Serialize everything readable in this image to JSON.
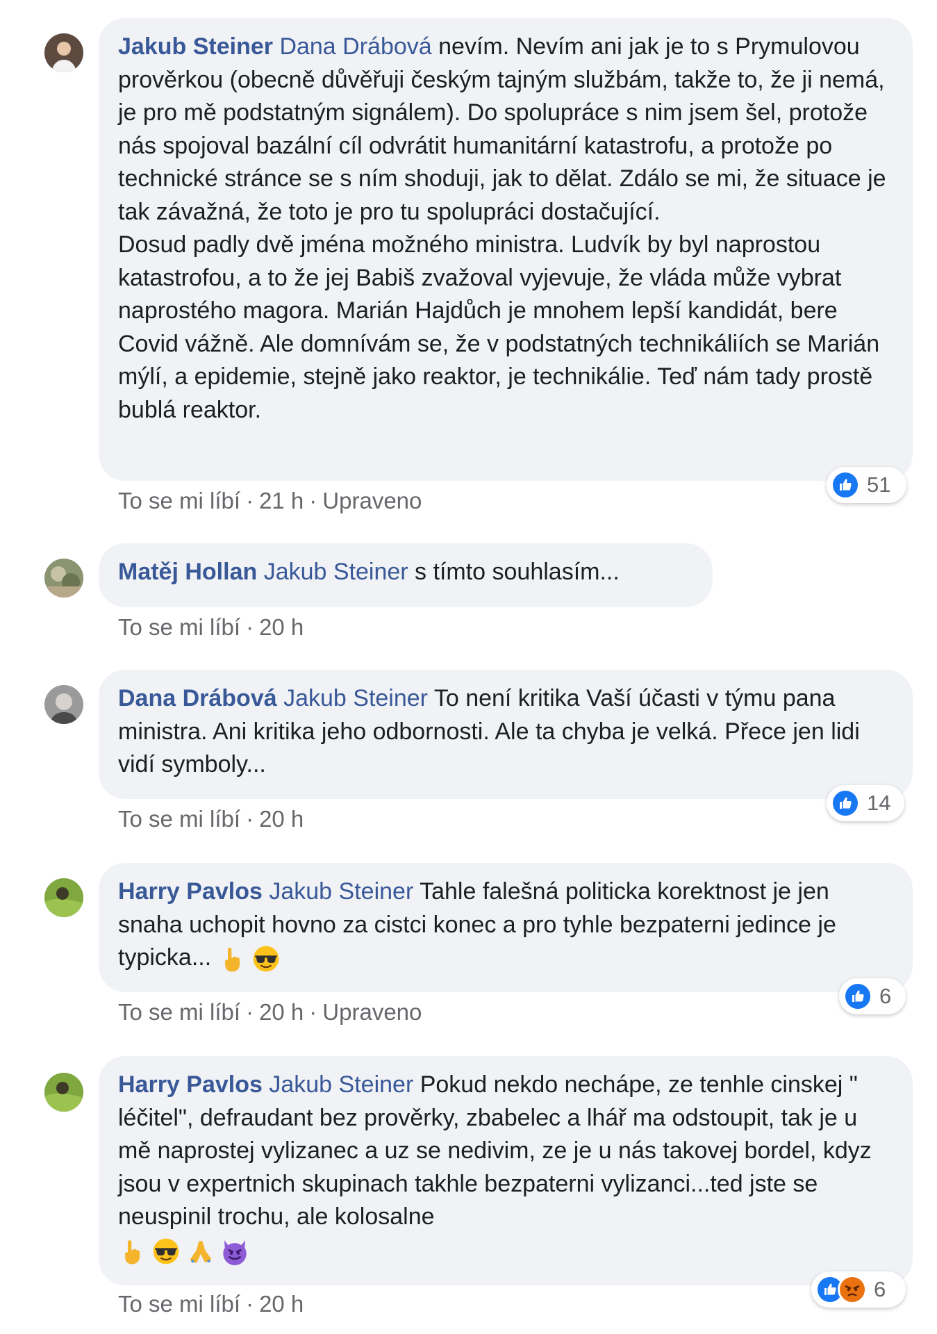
{
  "comments": [
    {
      "author": "Jakub Steiner",
      "tag": "Dana Drábová",
      "text": " nevím. Nevím ani jak je to s Prymulovou prověrkou (obecně důvěřuji českým tajným službám, takže to, že ji nemá, je pro mě podstatným signálem). Do spolupráce s nim jsem šel, protože nás spojoval bazální cíl odvrátit humanitární katastrofu, a protože po technické stránce se s ním shoduji, jak to dělat. Zdálo se mi, že situace je tak závažná, že toto je pro tu spolupráci dostačující.",
      "text2": "Dosud padly dvě jména možného ministra. Ludvík by byl naprostou katastrofou, a to že jej Babiš zvažoval vyjevuje, že vláda může vybrat naprostého magora. Marián Hajdůch je mnohem lepší kandidát, bere Covid vážně. Ale domnívám se, že v podstatných technikáliích se Marián mýlí, a epidemie, stejně jako reaktor, je technikálie. Teď nám tady prostě bublá reaktor.",
      "like_label": "To se mi líbí",
      "time": "21 h",
      "edited": "Upraveno",
      "reaction_count": "51"
    },
    {
      "author": "Matěj Hollan",
      "tag": "Jakub Steiner",
      "text": " s tímto souhlasím...",
      "like_label": "To se mi líbí",
      "time": "20 h"
    },
    {
      "author": "Dana Drábová",
      "tag": "Jakub Steiner",
      "text": " To není kritika Vaší účasti v týmu pana ministra. Ani kritika jeho odbornosti. Ale ta chyba je velká. Přece jen lidi vidí symboly...",
      "like_label": "To se mi líbí",
      "time": "20 h",
      "reaction_count": "14"
    },
    {
      "author": "Harry Pavlos",
      "tag": "Jakub Steiner",
      "text": " Tahle falešná politicka korektnost je jen snaha uchopit hovno za cistci konec a pro tyhle bezpaterni jedince je typicka...",
      "like_label": "To se mi líbí",
      "time": "20 h",
      "edited": "Upraveno",
      "reaction_count": "6"
    },
    {
      "author": "Harry Pavlos",
      "tag": "Jakub Steiner",
      "text": " Pokud nekdo nechápe, ze tenhle cinskej \" léčitel\", defraudant bez prověrky, zbabelec a lhář ma odstoupit, tak je u mě naprostej vylizanec a uz se nedivim, ze je u nás takovej bordel, kdyz jsou v expertnich skupinach takhle bezpaterni vylizanci...ted jste se neuspinil trochu, ale kolosalne",
      "like_label": "To se mi líbí",
      "time": "20 h",
      "reaction_count": "6"
    }
  ],
  "separator": "·",
  "icons": {
    "like": "like-reaction-icon",
    "angry": "angry-reaction-icon",
    "pointing": "pointing-up-emoji",
    "sunglasses": "sunglasses-emoji",
    "pray": "folded-hands-emoji",
    "devil": "smiling-devil-emoji"
  },
  "colors": {
    "name": "#385898",
    "bubble": "#f0f2f5",
    "meta": "#65676b",
    "like": "#1877f2",
    "angry": "#e9710f"
  }
}
